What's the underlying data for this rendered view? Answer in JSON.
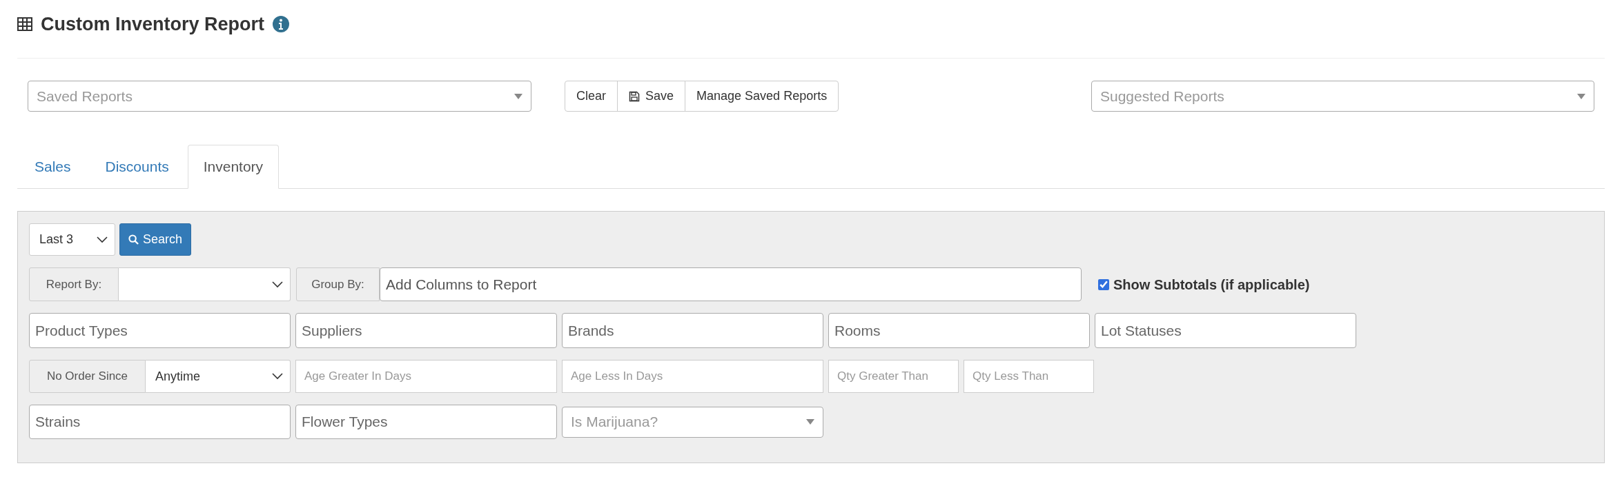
{
  "header": {
    "title": "Custom Inventory Report"
  },
  "saved_reports": {
    "placeholder": "Saved Reports"
  },
  "actions": [
    {
      "kind": "text",
      "label": "Clear"
    },
    {
      "kind": "save",
      "label": "Save"
    },
    {
      "kind": "text",
      "label": "Manage Saved Reports"
    }
  ],
  "suggested_reports": {
    "placeholder": "Suggested Reports"
  },
  "tabs": [
    {
      "label": "Sales",
      "selected": false
    },
    {
      "label": "Discounts",
      "selected": false
    },
    {
      "label": "Inventory",
      "selected": true
    }
  ],
  "filters": {
    "date_range": {
      "value": "Last 3"
    },
    "search_button": "Search",
    "report_by": {
      "label": "Report By:"
    },
    "group_by": {
      "label": "Group By:",
      "placeholder": "Add Columns to Report"
    },
    "show_subtotals": {
      "label": "Show Subtotals (if applicable)",
      "checked": true
    },
    "multi_selects": [
      {
        "placeholder": "Product Types"
      },
      {
        "placeholder": "Suppliers"
      },
      {
        "placeholder": "Brands"
      },
      {
        "placeholder": "Rooms"
      },
      {
        "placeholder": "Lot Statuses"
      }
    ],
    "no_order_since": {
      "label": "No Order Since",
      "value": "Anytime"
    },
    "numeric_inputs": [
      {
        "placeholder": "Age Greater In Days",
        "kind": "age"
      },
      {
        "placeholder": "Age Less In Days",
        "kind": "age"
      },
      {
        "placeholder": "Qty Greater Than",
        "kind": "qty"
      },
      {
        "placeholder": "Qty Less Than",
        "kind": "qty"
      }
    ],
    "last_row": [
      {
        "kind": "multi",
        "placeholder": "Strains"
      },
      {
        "kind": "multi",
        "placeholder": "Flower Types"
      },
      {
        "kind": "select",
        "placeholder": "Is Marijuana?"
      }
    ]
  }
}
